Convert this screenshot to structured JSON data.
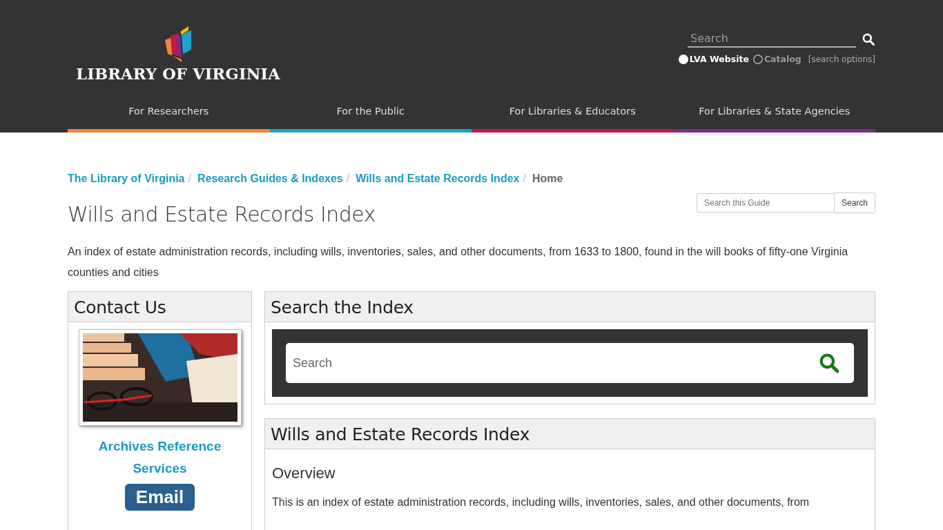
{
  "header": {
    "logo_text": "LIBRARY OF VIRGINIA",
    "search": {
      "placeholder": "Search"
    },
    "scopes": [
      {
        "label": "LVA Website",
        "selected": true
      },
      {
        "label": "Catalog",
        "selected": false
      }
    ],
    "search_options": "[search options]",
    "nav": [
      {
        "label": "For Researchers",
        "color": "#f0843c"
      },
      {
        "label": "For the Public",
        "color": "#1fa3c9"
      },
      {
        "label": "For Libraries & Educators",
        "color": "#c2184a"
      },
      {
        "label": "For Libraries & State Agencies",
        "color": "#7b2a8a"
      }
    ]
  },
  "breadcrumb": [
    {
      "label": "The Library of Virginia",
      "current": false,
      "separator": "/"
    },
    {
      "label": "Research Guides & Indexes",
      "current": false,
      "separator": "/"
    },
    {
      "label": "Wills and Estate Records Index",
      "current": false,
      "separator": "/"
    },
    {
      "label": "Home",
      "current": true
    }
  ],
  "title": "Wills and Estate Records Index",
  "guide_search": {
    "placeholder": "Search this Guide",
    "button": "Search"
  },
  "description": "An index of estate administration records, including wills, inventories, sales, and other documents, from 1633 to 1800, found in the will books of fifty-one Virginia counties and cities",
  "contact": {
    "title": "Contact Us",
    "name": "Archives Reference Services",
    "button": "Email"
  },
  "search_box": {
    "title": "Search the Index",
    "placeholder": "Search"
  },
  "index_box": {
    "title": "Wills and Estate Records Index",
    "heading": "Overview",
    "text": "This is an index of estate administration records, including wills, inventories, sales, and other documents, from"
  }
}
